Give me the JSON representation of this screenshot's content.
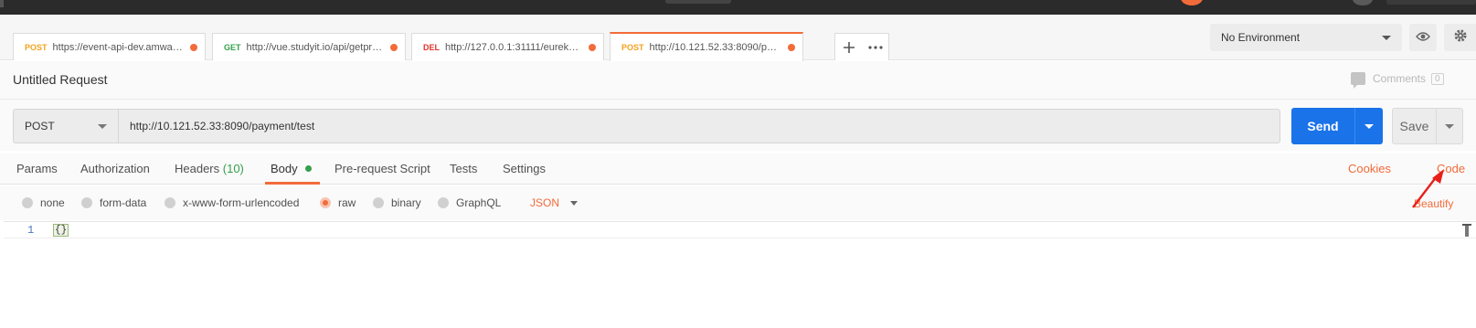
{
  "request_tabs": [
    {
      "method": "POST",
      "url": "https://event-api-dev.amwayn...",
      "method_color": "#f1a21e"
    },
    {
      "method": "GET",
      "url": "http://vue.studyit.io/api/getpro...",
      "method_color": "#34a04a"
    },
    {
      "method": "DEL",
      "url": "http://127.0.0.1:31111/eureka/...",
      "method_color": "#e0352b"
    },
    {
      "method": "POST",
      "url": "http://10.121.52.33:8090/pay...",
      "method_color": "#f1a21e",
      "active": true
    }
  ],
  "tab_actions": {
    "add_icon": "plus-icon",
    "more_icon": "ellipsis-icon"
  },
  "environment": {
    "selected": "No Environment",
    "eye_icon": "eye-icon",
    "settings_icon": "gear-icon"
  },
  "request": {
    "title": "Untitled Request",
    "comments_label": "Comments",
    "comments_count": "0",
    "method": "POST",
    "url": "http://10.121.52.33:8090/payment/test",
    "send_label": "Send",
    "save_label": "Save"
  },
  "section_tabs": {
    "params": "Params",
    "authorization": "Authorization",
    "headers": "Headers",
    "headers_count": "(10)",
    "body": "Body",
    "prerequest": "Pre-request Script",
    "tests": "Tests",
    "settings": "Settings",
    "cookies": "Cookies",
    "code": "Code"
  },
  "body_types": {
    "none": "none",
    "form_data": "form-data",
    "urlencoded": "x-www-form-urlencoded",
    "raw": "raw",
    "binary": "binary",
    "graphql": "GraphQL",
    "selected": "raw",
    "format": "JSON",
    "beautify": "Beautify"
  },
  "editor": {
    "line_number": "1",
    "content": "{}"
  },
  "colors": {
    "accent": "#f26b3a",
    "send_blue": "#1a73e8",
    "success_green": "#34a04a",
    "annotation_red": "#e8201a"
  }
}
